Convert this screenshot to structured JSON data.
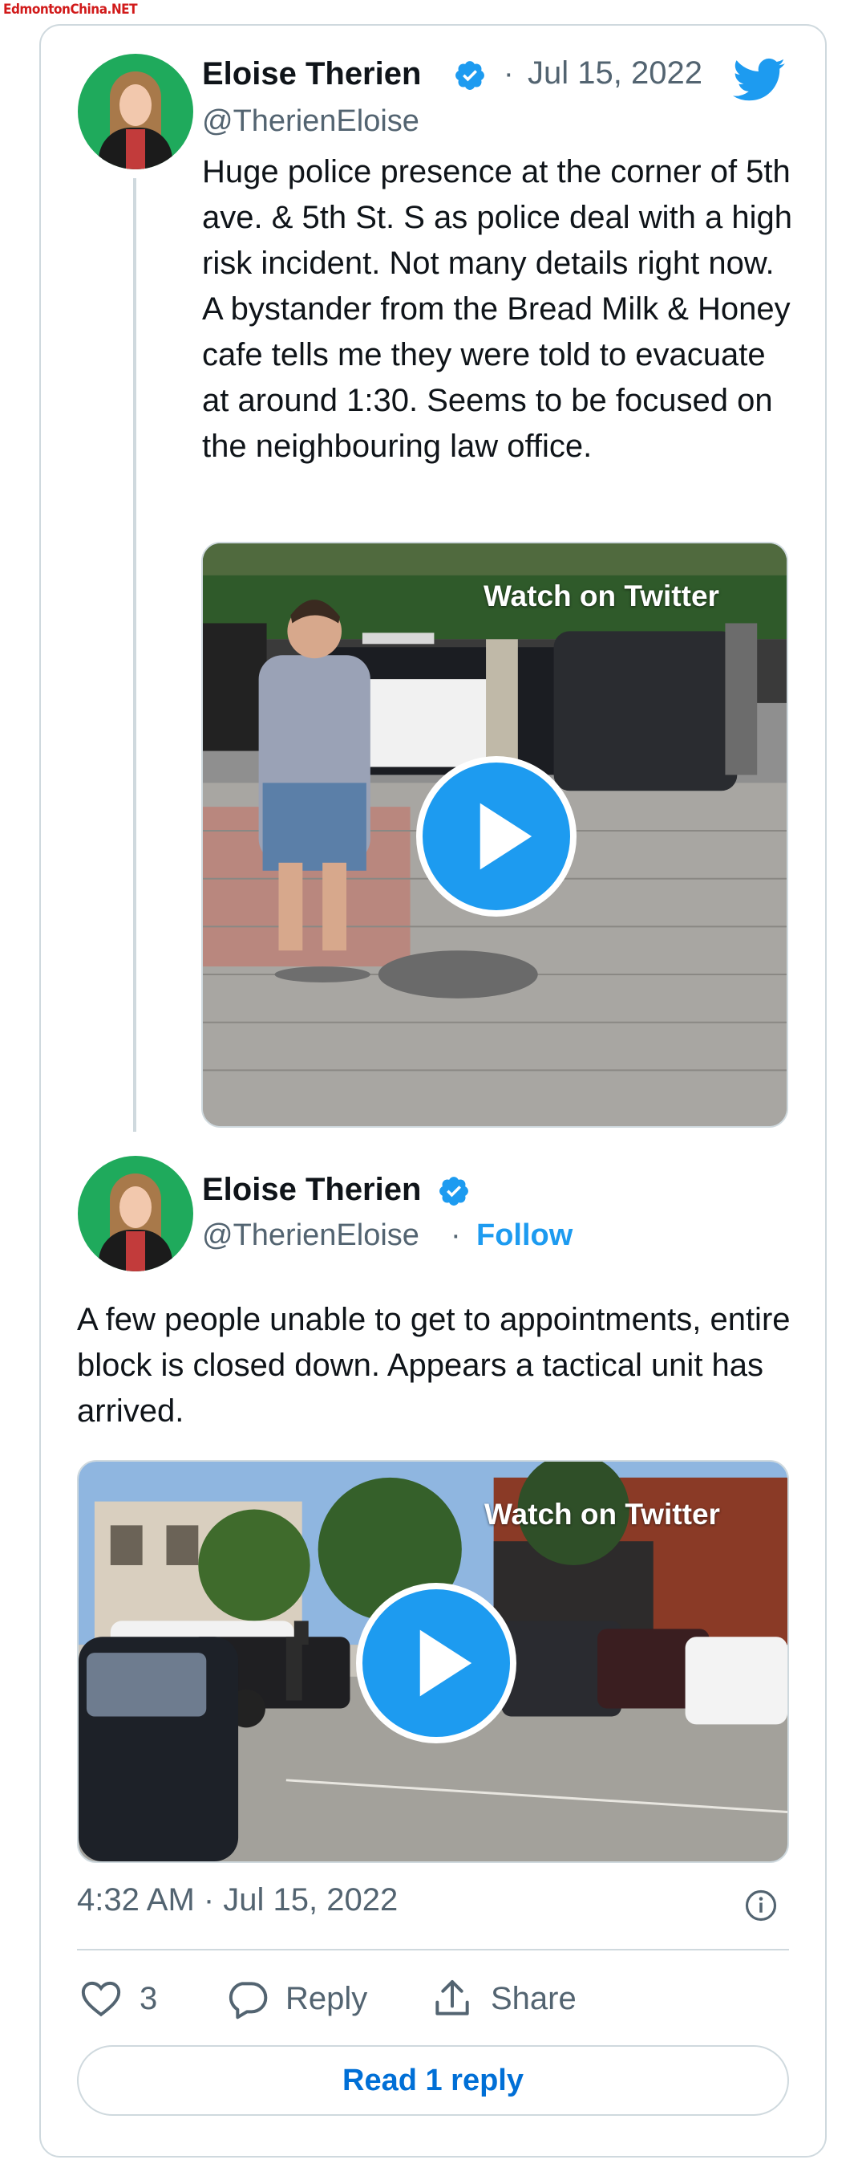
{
  "watermark": "EdmontonChina.NET",
  "tweet1": {
    "name": "Eloise Therien",
    "handle": "@TherienEloise",
    "separator": "·",
    "date": "Jul 15, 2022",
    "text": "Huge police presence at the corner of 5th ave. & 5th St. S as police deal with a high risk incident. Not many details right now. A bystander from the Bread Milk & Honey cafe tells me they were told to evacuate at around 1:30. Seems to be focused on the neighbouring law office.",
    "media_label": "Watch on Twitter"
  },
  "tweet2": {
    "name": "Eloise Therien",
    "handle": "@TherienEloise",
    "separator": "·",
    "follow_label": "Follow",
    "text": "A few people unable to get to appointments, entire block is closed down. Appears a tactical unit has arrived.",
    "media_label": "Watch on Twitter",
    "timestamp": "4:32 AM · Jul 15, 2022"
  },
  "actions": {
    "like_count": "3",
    "reply_label": "Reply",
    "share_label": "Share"
  },
  "read_reply_label": "Read 1 reply",
  "colors": {
    "twitter_blue": "#1d9bf0",
    "text_primary": "#0f1419",
    "text_secondary": "#536471",
    "border": "#cfd9de",
    "link": "#006fd6"
  },
  "icons": [
    "verified-badge-icon",
    "twitter-bird-icon",
    "play-icon",
    "info-icon",
    "heart-icon",
    "reply-bubble-icon",
    "share-icon"
  ]
}
